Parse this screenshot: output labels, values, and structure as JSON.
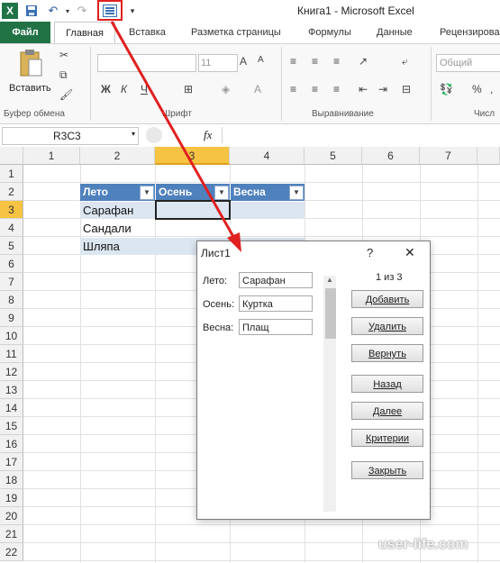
{
  "window": {
    "title": "Книга1 - Microsoft Excel"
  },
  "ribbon": {
    "tabs": [
      "Файл",
      "Главная",
      "Вставка",
      "Разметка страницы",
      "Формулы",
      "Данные",
      "Рецензирова"
    ],
    "groups": [
      "Буфер обмена",
      "Шрифт",
      "Выравнивание",
      "Числ"
    ],
    "paste_label": "Вставить",
    "font_size": "11",
    "number_format": "Общий",
    "percent": "%"
  },
  "formula_bar": {
    "name_box": "R3C3",
    "fx": "fx",
    "value": ""
  },
  "grid": {
    "columns": [
      "1",
      "2",
      "3",
      "4",
      "5",
      "6",
      "7"
    ],
    "rows": [
      "1",
      "2",
      "3",
      "4",
      "5",
      "6",
      "7",
      "8",
      "9",
      "10",
      "11",
      "12",
      "13",
      "14",
      "15",
      "16",
      "17",
      "18",
      "19",
      "20",
      "21",
      "22"
    ],
    "table_headers": [
      "Лето",
      "Осень",
      "Весна"
    ],
    "table_cells": [
      "Сарафан",
      "Сандали",
      "Шляпа"
    ]
  },
  "dialog": {
    "title": "Лист1",
    "help": "?",
    "close": "✕",
    "record_counter": "1 из 3",
    "fields": [
      {
        "label": "Лето:",
        "value": "Сарафан"
      },
      {
        "label": "Осень:",
        "value": "Куртка"
      },
      {
        "label": "Весна:",
        "value": "Плащ"
      }
    ],
    "buttons": [
      "Добавить",
      "Удалить",
      "Вернуть",
      "Назад",
      "Далее",
      "Критерии",
      "Закрыть"
    ]
  },
  "watermark": "user-life.com",
  "colors": {
    "file_tab": "#217346",
    "table_header": "#4f81bd",
    "selected_column": "#f6c343",
    "annotation": "#e02020"
  }
}
